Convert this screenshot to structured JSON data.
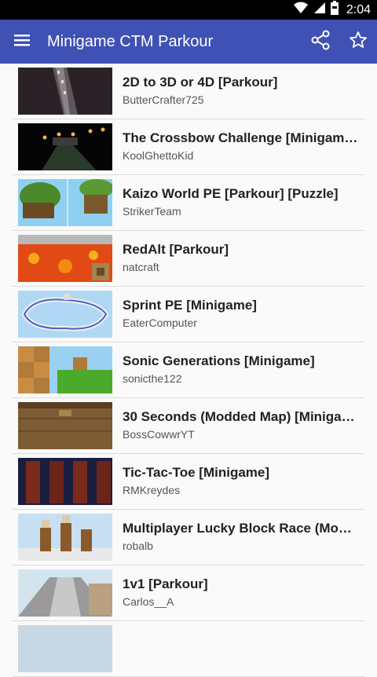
{
  "status_bar": {
    "time": "2:04",
    "icons": [
      "wifi-icon",
      "signal-icon",
      "battery-icon"
    ]
  },
  "app_bar": {
    "title": "Minigame CTM Parkour",
    "icons": [
      "menu-icon",
      "share-icon",
      "star-icon"
    ]
  },
  "items": [
    {
      "title": "2D to 3D or 4D [Parkour]",
      "author": "ButterCrafter725"
    },
    {
      "title": "The Crossbow Challenge [Minigam…",
      "author": "KoolGhettoKid"
    },
    {
      "title": "Kaizo World PE [Parkour] [Puzzle]",
      "author": "StrikerTeam"
    },
    {
      "title": "RedAlt [Parkour]",
      "author": "natcraft"
    },
    {
      "title": "Sprint PE [Minigame]",
      "author": "EaterComputer"
    },
    {
      "title": "Sonic Generations [Minigame]",
      "author": "sonicthe122"
    },
    {
      "title": "30 Seconds (Modded Map) [Miniga…",
      "author": "BossCowwrYT"
    },
    {
      "title": "Tic-Tac-Toe [Minigame]",
      "author": " RMKreydes"
    },
    {
      "title": "Multiplayer Lucky Block Race (Mo…",
      "author": "robalb"
    },
    {
      "title": "1v1 [Parkour]",
      "author": "Carlos__A"
    }
  ]
}
